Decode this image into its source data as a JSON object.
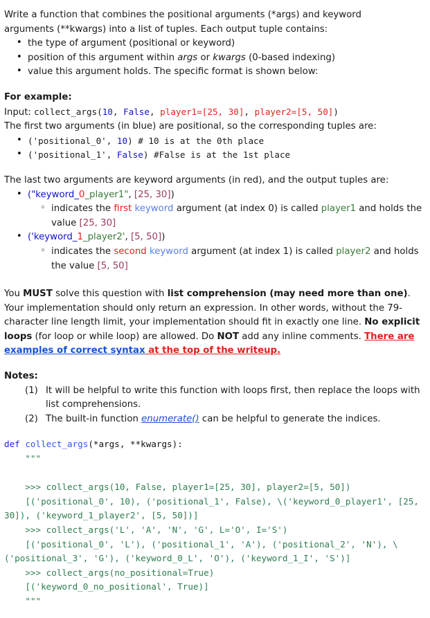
{
  "document": {
    "clipped_top_text": "the type of argument (positional or keyword) — scrolled above view",
    "intro": {
      "line1": "Write a function that combines the positional arguments (*args) and keyword",
      "line2": "arguments (**kwargs) into a list of tuples. Each output tuple contains:",
      "bullets": [
        "the type of argument (positional or keyword)",
        {
          "prefix": "position of this argument within ",
          "em1": "args",
          "mid": " or ",
          "em2": "kwargs",
          "suffix": " (0-based indexing)"
        },
        "value this argument holds. The specific format is shown below:"
      ]
    },
    "example": {
      "heading": "For example:",
      "input_label": "Input: ",
      "input_code": {
        "fn": "collect_args(",
        "arg0": "10",
        "sep0": ", ",
        "arg1": "False",
        "sep1": ", ",
        "kw0": "player1=[25, 30]",
        "sep2": ", ",
        "kw1": "player2=[5, 50]",
        "close": ")"
      },
      "positional_intro": "The first two arguments (in blue) are positional, so the corresponding tuples are:",
      "positional_bullets": [
        {
          "open": "('positional_0', ",
          "value": "10",
          "close": ")",
          "comment": "  # 10 is at the 0th place"
        },
        {
          "open": "('positional_1', ",
          "value": "False",
          "close": ")",
          "comment": "  #False is at the 1st place"
        }
      ],
      "keyword_intro": "The last two arguments are keyword arguments (in red), and the output tuples are:",
      "keyword_bullets": [
        {
          "tuple": {
            "open": "(\"keyword_",
            "index": "0",
            "name": "_player1\"",
            "comma": ", ",
            "value": "[25, 30]",
            "close": ")"
          },
          "explain": {
            "t1": "indicates the ",
            "ordinal": "first",
            "t2": " ",
            "kw": "keyword",
            "t3": " argument (at index 0) is called ",
            "name": "player1",
            "t4": " and holds the value ",
            "value": "[25, 30]"
          }
        },
        {
          "tuple": {
            "open": "('keyword_",
            "index": "1",
            "name": "_player2'",
            "comma": ", ",
            "value": "[5, 50]",
            "close": ")"
          },
          "explain": {
            "t1": "indicates the ",
            "ordinal": "second",
            "t2": " ",
            "kw": "keyword",
            "t3": " argument (at index 1) is called ",
            "name": "player2",
            "t4": " and holds the value ",
            "value": "[5, 50]"
          }
        }
      ]
    },
    "requirements": {
      "t1": "You ",
      "b1": "MUST",
      "t2": " solve this question with ",
      "b2": "list comprehension (may need more than one)",
      "t3": ". Your implementation should only return an expression. In other words, without the 79-character line length limit, your implementation should fit in exactly one line. ",
      "b3": "No explicit loops",
      "t4": " (for loop or while loop) are allowed. Do ",
      "b4": "NOT",
      "t5": " add any inline comments. ",
      "link": {
        "before": "There are ",
        "anchor": "examples of correct syntax",
        "after": " at the top of the writeup."
      }
    },
    "notes": {
      "heading": "Notes:",
      "items": [
        {
          "text": "It will be helpful to write this function with loops first, then replace the loops with list comprehensions."
        },
        {
          "before": "The built-in function ",
          "link": "enumerate()",
          "after": " can be helpful to generate the indices."
        }
      ]
    },
    "code": {
      "def_keyword": "def",
      "fn_name": " collect_args",
      "signature": "(*args, **kwargs):",
      "docstring_open": "    \"\"\"",
      "blank": "",
      "body_lines": [
        "    >>> collect_args(10, False, player1=[25, 30], player2=[5, 50])",
        "    [('positional_0', 10), ('positional_1', False), \\",
        "('keyword_0_player1', [25, 30]), ('keyword_1_player2', [5, 50])]",
        "    >>> collect_args('L', 'A', 'N', 'G', L='O', I='S')",
        "    [('positional_0', 'L'), ('positional_1', 'A'), ('positional_2', 'N'), \\",
        "('positional_3', 'G'), ('keyword_0_L', 'O'), ('keyword_1_I', 'S')]",
        "    >>> collect_args(no_positional=True)",
        "    [('keyword_0_no_positional', True)]"
      ],
      "docstring_close": "    \"\"\""
    },
    "colors": {
      "blue": "#1111cc",
      "red": "#e02020",
      "green": "#3b7a3b",
      "purple": "#9a3b62",
      "keyword_blue": "#5b7fe0",
      "link_blue": "#1a4fd6",
      "code_green": "#2e7d4f",
      "def_blue": "#2222dd",
      "text": "#1a1a1a",
      "background": "#ffffff"
    }
  }
}
